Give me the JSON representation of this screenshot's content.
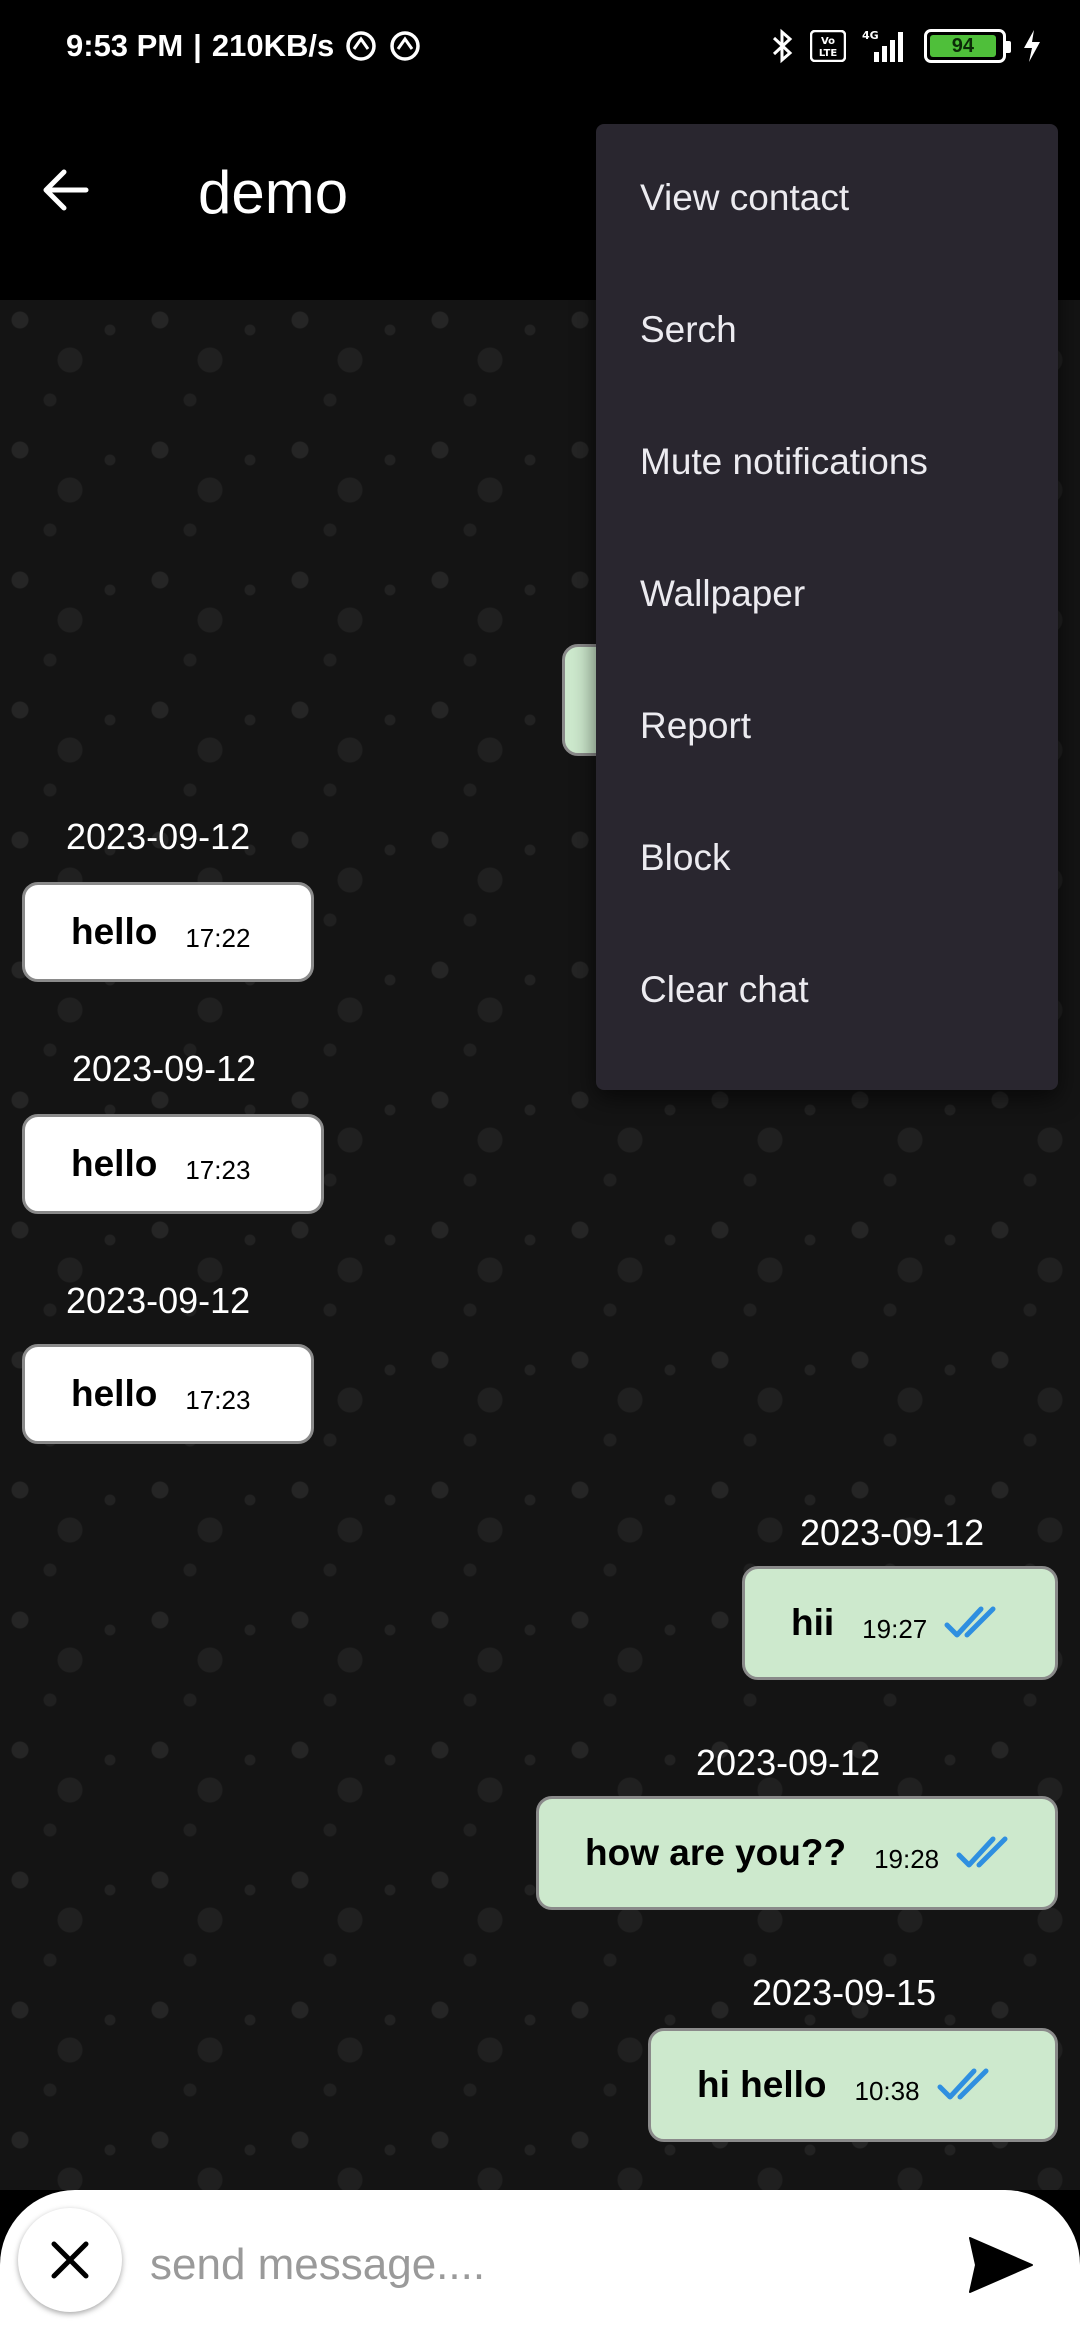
{
  "status_bar": {
    "time": "9:53 PM",
    "separator": "|",
    "speed": "210KB/s",
    "network": "4G",
    "volte": "Vo LTE",
    "battery": "94",
    "battery_level": 0.94
  },
  "header": {
    "title": "demo"
  },
  "messages": [
    {
      "date": "2023-09-12",
      "text": "hello",
      "time": "17:22",
      "direction": "in"
    },
    {
      "date": "2023-09-12",
      "text": "hello",
      "time": "17:23",
      "direction": "in"
    },
    {
      "date": "2023-09-12",
      "text": "hello",
      "time": "17:23",
      "direction": "in"
    },
    {
      "date": "2023-09-12",
      "text": "hii",
      "time": "19:27",
      "direction": "out"
    },
    {
      "date": "2023-09-12",
      "text": "how are you??",
      "time": "19:28",
      "direction": "out"
    },
    {
      "date": "2023-09-15",
      "text": "hi hello",
      "time": "10:38",
      "direction": "out"
    }
  ],
  "menu": {
    "items": [
      "View contact",
      "Serch",
      "Mute notifications",
      "Wallpaper",
      "Report",
      "Block",
      "Clear chat"
    ]
  },
  "input": {
    "placeholder": "send message....",
    "value": ""
  },
  "colors": {
    "incoming_bubble": "#ffffff",
    "outgoing_bubble": "#cde9cd",
    "read_ticks": "#2f8fe0",
    "menu_bg": "#29262f"
  },
  "icons": {
    "back": "arrow-left-icon",
    "close": "close-icon",
    "send": "send-icon",
    "read_receipt": "double-check-icon"
  }
}
